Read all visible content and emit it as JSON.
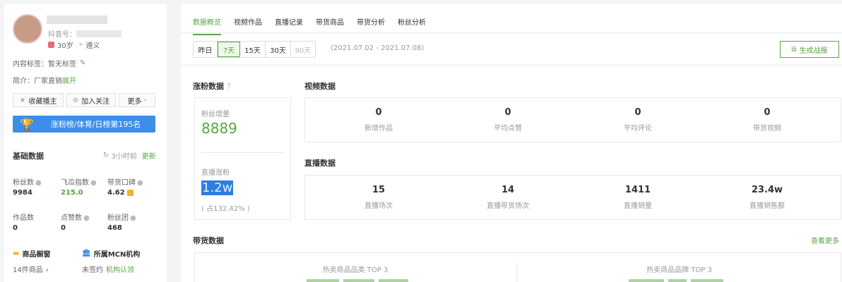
{
  "profile": {
    "douyin_id_label": "抖音号：",
    "age": "30岁",
    "location": "遵义",
    "content_tag_label": "内容标签：",
    "content_tag_value": "暂无标签",
    "intro_label": "简介：",
    "intro_value": "厂家直销",
    "expand": "展开"
  },
  "actions": {
    "favorite": "收藏播主",
    "follow": "加入关注",
    "more": "更多"
  },
  "rank_banner": "涨粉榜/体育/日榜第195名",
  "basic": {
    "title": "基础数据",
    "updated": "3小时前",
    "refresh": "更新",
    "metrics": [
      {
        "label": "粉丝数",
        "value": "9984"
      },
      {
        "label": "飞瓜指数",
        "value": "215.0"
      },
      {
        "label": "带货口碑",
        "value": "4.62"
      },
      {
        "label": "作品数",
        "value": "0"
      },
      {
        "label": "点赞数",
        "value": "0"
      },
      {
        "label": "粉丝团",
        "value": "468"
      }
    ],
    "goods_title": "商品橱窗",
    "goods_value": "14件商品",
    "mcn_title": "所属MCN机构",
    "mcn_value": "未签约",
    "mcn_link": "机构认领"
  },
  "tabs": [
    "数据概览",
    "视频作品",
    "直播记录",
    "带货商品",
    "带货分析",
    "粉丝分析"
  ],
  "ranges": [
    "昨日",
    "7天",
    "15天",
    "30天",
    "90天"
  ],
  "date_range": "(2021.07.02 - 2021.07.08)",
  "report_button": "生成战报",
  "fans": {
    "title": "涨粉数据",
    "growth_label": "粉丝增量",
    "growth_value": "8889",
    "live_label": "直播涨粉",
    "live_value": "1.2w",
    "live_ratio": "( 占132.42% )"
  },
  "video": {
    "title": "视频数据",
    "metrics": [
      {
        "value": "0",
        "label": "新增作品"
      },
      {
        "value": "0",
        "label": "平均点赞"
      },
      {
        "value": "0",
        "label": "平均评论"
      },
      {
        "value": "0",
        "label": "带货视频"
      }
    ]
  },
  "live": {
    "title": "直播数据",
    "metrics": [
      {
        "value": "15",
        "label": "直播场次"
      },
      {
        "value": "14",
        "label": "直播带货场次"
      },
      {
        "value": "1411",
        "label": "直播销量"
      },
      {
        "value": "23.4w",
        "label": "直播销售额"
      }
    ]
  },
  "sales": {
    "title": "带货数据",
    "more": "查看更多",
    "category_top": "热卖商品品类 TOP 3",
    "brand_top": "热卖商品品牌 TOP 3"
  },
  "colors": {
    "accent": "#5aa541",
    "banner": "#3d8ee8",
    "gold": "#f0b429"
  }
}
